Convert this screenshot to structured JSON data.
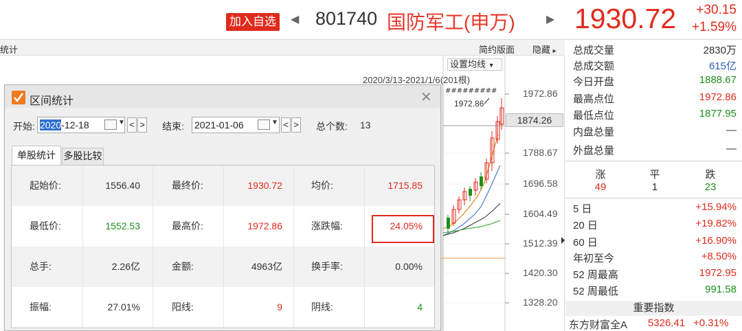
{
  "header": {
    "add_button": "加入自选",
    "prev_arrow": "◀",
    "next_arrow": "▶",
    "code": "801740",
    "name": "国防军工(申万)",
    "price": "1930.72",
    "change_abs": "+30.15",
    "change_pct": "+1.59%"
  },
  "chart": {
    "toolbar_title": "统计",
    "simple_layout": "简约版面",
    "hide": "隐藏",
    "hide_icon": "▸",
    "set_ma": "设置均线",
    "set_ma_icon": "▼",
    "range_label": "2020/3/13-2021/1/6(201根)",
    "peak_label": "1972.86",
    "current_tag": "1874.26",
    "y_labels": [
      "1972.86",
      "1788.67",
      "1696.58",
      "1604.49",
      "1512.39",
      "1420.30",
      "1328.20"
    ],
    "colors": {
      "up": "#e02b1c",
      "down": "#1d8f1d",
      "ma5": "#e08a1e",
      "ma10": "#4a7fd0",
      "ma20": "#333333",
      "ma60": "#2aa02a"
    }
  },
  "dialog": {
    "title": "区间统计",
    "close": "✕",
    "start_label": "开始:",
    "start_year": "2020",
    "start_rest": "-12-18",
    "end_label": "结束:",
    "end_date": "2021-01-06",
    "count_label": "总个数:",
    "count_value": "13",
    "prev_btn": "<",
    "next_btn": ">",
    "tab_single": "单股统计",
    "tab_multi": "多股比较",
    "rows": [
      [
        {
          "label": "起始价:",
          "value": "1556.40"
        },
        {
          "label": "最终价:",
          "value": "1930.72"
        },
        {
          "label": "均价:",
          "value": "1715.85"
        }
      ],
      [
        {
          "label": "最低价:",
          "value": "1552.53"
        },
        {
          "label": "最高价:",
          "value": "1972.86"
        },
        {
          "label": "涨跌幅:",
          "value": "24.05%"
        }
      ],
      [
        {
          "label": "总手:",
          "value": "2.26亿"
        },
        {
          "label": "金额:",
          "value": "4963亿"
        },
        {
          "label": "换手率:",
          "value": "0.00%"
        }
      ],
      [
        {
          "label": "振幅:",
          "value": "27.01%"
        },
        {
          "label": "阳线:",
          "value": "9"
        },
        {
          "label": "阴线:",
          "value": "4"
        }
      ]
    ]
  },
  "panel": {
    "stats": [
      {
        "label": "总成交量",
        "value": "2830万"
      },
      {
        "label": "总成交额",
        "value": "615亿"
      },
      {
        "label": "今日开盘",
        "value": "1888.67"
      },
      {
        "label": "最高点位",
        "value": "1972.86"
      },
      {
        "label": "最低点位",
        "value": "1877.95"
      },
      {
        "label": "内盘总量",
        "value": "—"
      },
      {
        "label": "外盘总量",
        "value": "—"
      }
    ],
    "udf": {
      "up_label": "涨",
      "flat_label": "平",
      "down_label": "跌",
      "up": "49",
      "flat": "1",
      "down": "23"
    },
    "perf": [
      {
        "label": "5 日",
        "value": "+15.94%"
      },
      {
        "label": "20 日",
        "value": "+19.82%"
      },
      {
        "label": "60 日",
        "value": "+16.90%"
      },
      {
        "label": "年初至今",
        "value": "+8.50%"
      },
      {
        "label": "52 周最高",
        "value": "1972.95"
      },
      {
        "label": "52 周最低",
        "value": "991.58"
      }
    ],
    "index_header": "重要指数",
    "index_row": {
      "name": "东方财富全A",
      "value": "5326.41",
      "change": "+0.31%"
    }
  }
}
